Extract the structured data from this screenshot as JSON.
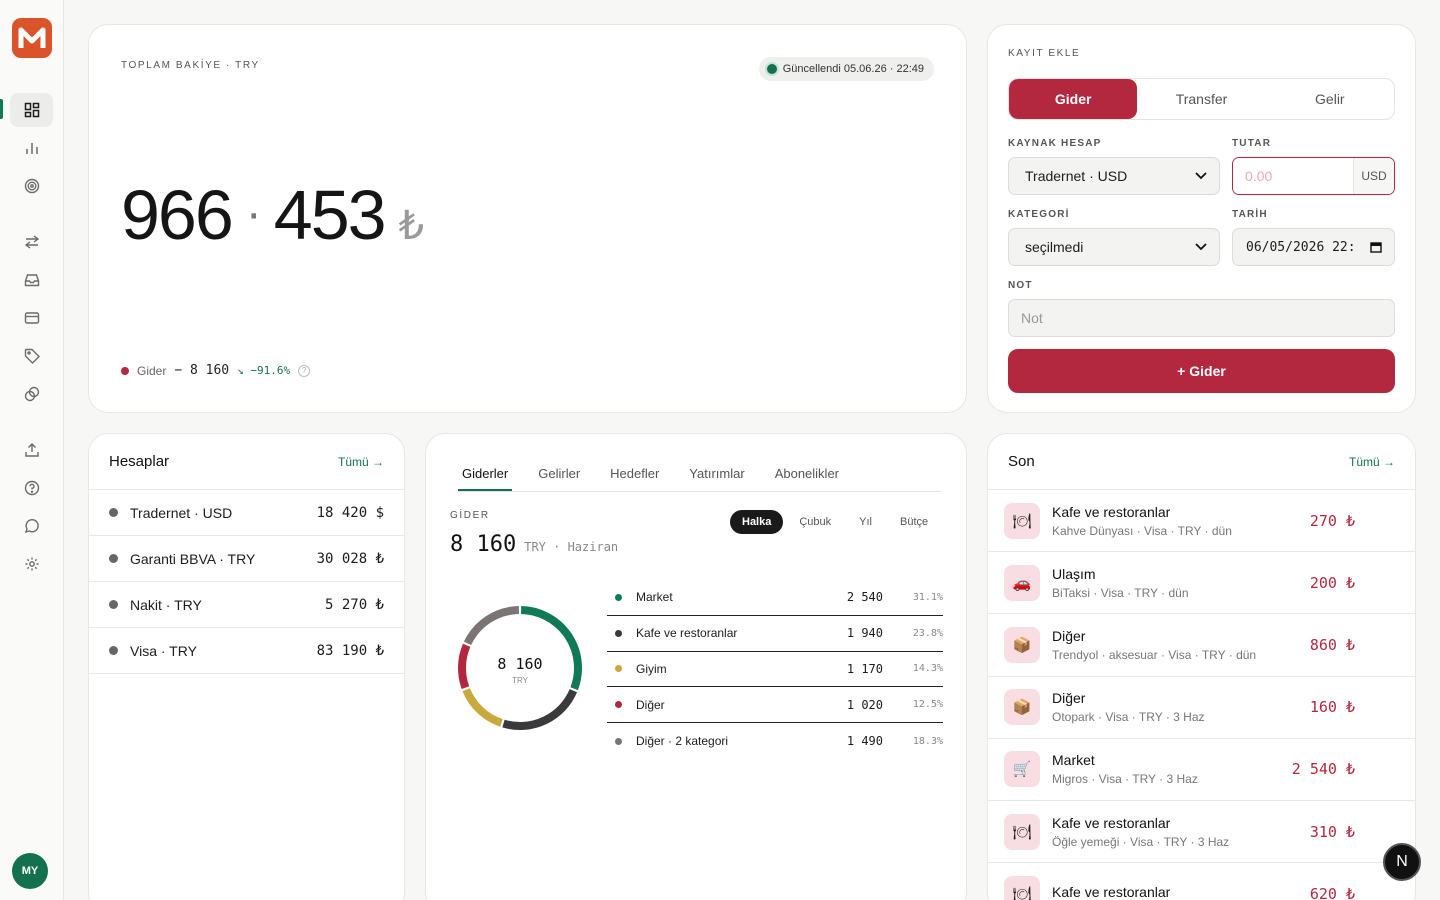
{
  "app": {
    "logo_letter": "M",
    "brand_color": "#d9542a",
    "accent": "#b3283f",
    "positive": "#13714f"
  },
  "sidebar": {
    "items": [
      {
        "name": "dashboard-icon",
        "active": true
      },
      {
        "name": "chart-icon"
      },
      {
        "name": "target-icon"
      },
      {
        "name": "transfer-icon"
      },
      {
        "name": "inbox-icon"
      },
      {
        "name": "card-icon"
      },
      {
        "name": "tag-icon"
      },
      {
        "name": "coins-icon"
      },
      {
        "name": "upload-icon"
      },
      {
        "name": "help-icon"
      },
      {
        "name": "chat-icon"
      },
      {
        "name": "settings-icon"
      }
    ],
    "avatar": "MY"
  },
  "balance": {
    "eyebrow": "TOPLAM BAKİYE · TRY",
    "updated": "Güncellendi 05.06.26 · 22:49",
    "int_part": "966",
    "sep": "·",
    "frac_part": "453",
    "currency": "₺",
    "expense_label": "Gider",
    "expense_value": "− 8 160",
    "expense_change": "↘ −91.6%",
    "help": "?"
  },
  "add_record": {
    "title": "KAYIT EKLE",
    "types": [
      "Gider",
      "Transfer",
      "Gelir"
    ],
    "source_label": "KAYNAK HESAP",
    "source_value": "Tradernet · USD",
    "amount_label": "TUTAR",
    "amount_placeholder": "0.00",
    "amount_unit": "USD",
    "category_label": "KATEGORİ",
    "category_value": "seçilmedi",
    "date_label": "TARİH",
    "date_value": "06/05/2026 22:",
    "note_label": "NOT",
    "note_placeholder": "Not",
    "submit": "+ Gider"
  },
  "accounts": {
    "title": "Hesaplar",
    "all": "Tümü →",
    "rows": [
      {
        "name": "Tradernet · USD",
        "amount": "18 420 $"
      },
      {
        "name": "Garanti BBVA · TRY",
        "amount": "30 028 ₺"
      },
      {
        "name": "Nakit · TRY",
        "amount": "5 270 ₺"
      },
      {
        "name": "Visa · TRY",
        "amount": "83 190 ₺"
      }
    ]
  },
  "breakdown": {
    "tabs": [
      "Giderler",
      "Gelirler",
      "Hedefler",
      "Yatırımlar",
      "Abonelikler"
    ],
    "views": [
      "Halka",
      "Çubuk",
      "Yıl",
      "Bütçe"
    ],
    "label": "GİDER",
    "total": "8 160",
    "total_suffix": "TRY · Haziran",
    "donut_value": "8 160",
    "donut_unit": "TRY",
    "categories": [
      {
        "name": "Market",
        "value": "2 540",
        "pct": "31.1%",
        "color": "#0f7a55",
        "share": 31.1
      },
      {
        "name": "Kafe ve restoranlar",
        "value": "1 940",
        "pct": "23.8%",
        "color": "#3a3a3d",
        "share": 23.8
      },
      {
        "name": "Giyim",
        "value": "1 170",
        "pct": "14.3%",
        "color": "#c9a83c",
        "share": 14.3
      },
      {
        "name": "Diğer",
        "value": "1 020",
        "pct": "12.5%",
        "color": "#b3283f",
        "share": 12.5
      },
      {
        "name": "Diğer · 2 kategori",
        "value": "1 490",
        "pct": "18.3%",
        "color": "#7a7572",
        "share": 18.3
      }
    ]
  },
  "recent": {
    "title": "Son",
    "all": "Tümü →",
    "rows": [
      {
        "icon": "🍽",
        "title": "Kafe ve restoranlar",
        "sub": "Kahve Dünyası · Visa · TRY · dün",
        "amount": "270 ₺"
      },
      {
        "icon": "🚗",
        "title": "Ulaşım",
        "sub": "BiTaksi · Visa · TRY · dün",
        "amount": "200 ₺"
      },
      {
        "icon": "📦",
        "title": "Diğer",
        "sub": "Trendyol · aksesuar · Visa · TRY · dün",
        "amount": "860 ₺"
      },
      {
        "icon": "📦",
        "title": "Diğer",
        "sub": "Otopark · Visa · TRY · 3 Haz",
        "amount": "160 ₺"
      },
      {
        "icon": "🛒",
        "title": "Market",
        "sub": "Migros · Visa · TRY · 3 Haz",
        "amount": "2 540 ₺"
      },
      {
        "icon": "🍽",
        "title": "Kafe ve restoranlar",
        "sub": "Öğle yemeği · Visa · TRY · 3 Haz",
        "amount": "310 ₺"
      },
      {
        "icon": "🍽",
        "title": "Kafe ve restoranlar",
        "sub": "",
        "amount": "620 ₺"
      }
    ]
  },
  "floating": {
    "label": "N"
  }
}
